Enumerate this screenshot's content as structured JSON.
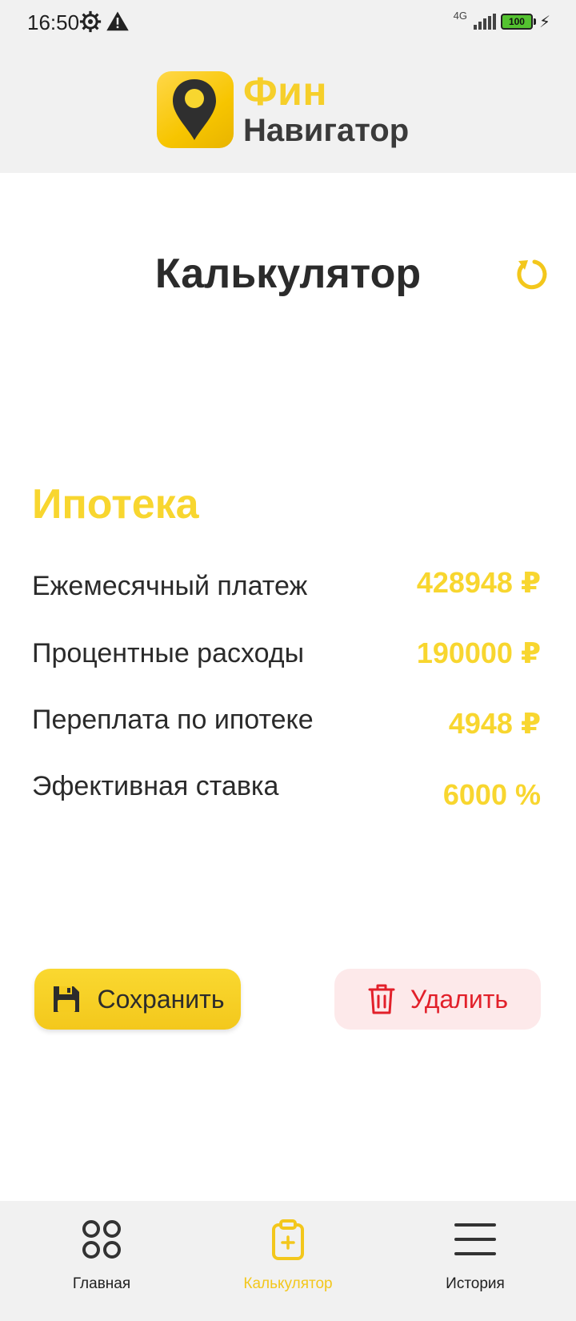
{
  "status_bar": {
    "time": "16:50",
    "network": "4G",
    "battery": "100"
  },
  "brand": {
    "line1": "Фин",
    "line2": "Навигатор",
    "accent_color": "#f8d62f"
  },
  "page": {
    "title": "Калькулятор"
  },
  "section": {
    "title": "Ипотека",
    "rows": [
      {
        "label": "Ежемесячный платеж",
        "value": "428948 ₽"
      },
      {
        "label": "Процентные расходы",
        "value": "190000 ₽"
      },
      {
        "label": "Переплата по ипотеке",
        "value": "4948 ₽"
      },
      {
        "label": "Эфективная ставка",
        "value": "6000 %"
      }
    ]
  },
  "actions": {
    "save_label": "Сохранить",
    "delete_label": "Удалить",
    "delete_color": "#e2202a"
  },
  "nav": {
    "items": [
      {
        "label": "Главная",
        "icon": "grid-icon",
        "active": false
      },
      {
        "label": "Калькулятор",
        "icon": "clipboard-plus-icon",
        "active": true
      },
      {
        "label": "История",
        "icon": "menu-icon",
        "active": false
      }
    ]
  }
}
